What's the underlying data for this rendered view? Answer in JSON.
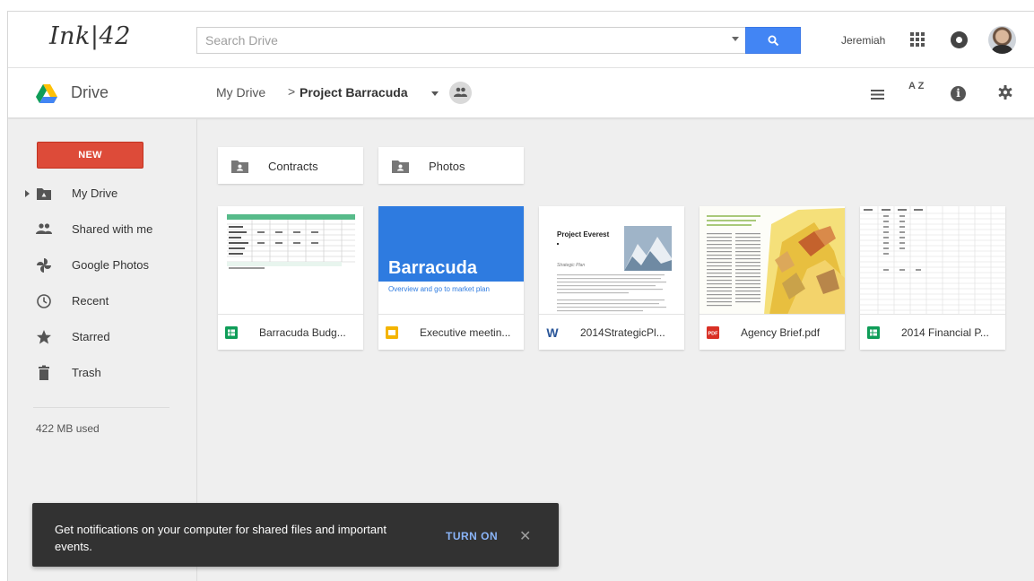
{
  "header": {
    "logo": "Ink|42",
    "search_placeholder": "Search Drive",
    "username": "Jeremiah"
  },
  "subheader": {
    "app_name": "Drive",
    "breadcrumb_root": "My Drive",
    "breadcrumb_separator": ">",
    "breadcrumb_current": "Project Barracuda",
    "sort_label": "A Z"
  },
  "sidebar": {
    "new_label": "NEW",
    "items": [
      {
        "label": "My Drive",
        "icon": "drive-folder-icon"
      },
      {
        "label": "Shared with me",
        "icon": "people-icon"
      },
      {
        "label": "Google Photos",
        "icon": "pinwheel-icon"
      },
      {
        "label": "Recent",
        "icon": "clock-icon"
      },
      {
        "label": "Starred",
        "icon": "star-icon"
      },
      {
        "label": "Trash",
        "icon": "trash-icon"
      }
    ],
    "storage": "422 MB used"
  },
  "folders": [
    {
      "name": "Contracts"
    },
    {
      "name": "Photos"
    }
  ],
  "files": [
    {
      "name": "Barracuda Budg...",
      "type": "sheets",
      "color": "#0f9d58"
    },
    {
      "name": "Executive meetin...",
      "type": "slides",
      "color": "#f4b400",
      "thumb_title": "Barracuda",
      "thumb_subtitle": "Overview and go to market plan"
    },
    {
      "name": "2014StrategicPl...",
      "type": "word",
      "color": "#2a5699",
      "thumb_title": "Project Everest",
      "thumb_subtitle": "Strategic Plan"
    },
    {
      "name": "Agency Brief.pdf",
      "type": "pdf",
      "color": "#d93025"
    },
    {
      "name": "2014 Financial P...",
      "type": "sheets",
      "color": "#0f9d58"
    }
  ],
  "snackbar": {
    "message": "Get notifications on your computer for shared files and important events.",
    "action": "TURN ON",
    "close": "✕"
  },
  "colors": {
    "accent_blue": "#4285f4",
    "new_red": "#dd4b39",
    "snackbar_bg": "#323232"
  }
}
